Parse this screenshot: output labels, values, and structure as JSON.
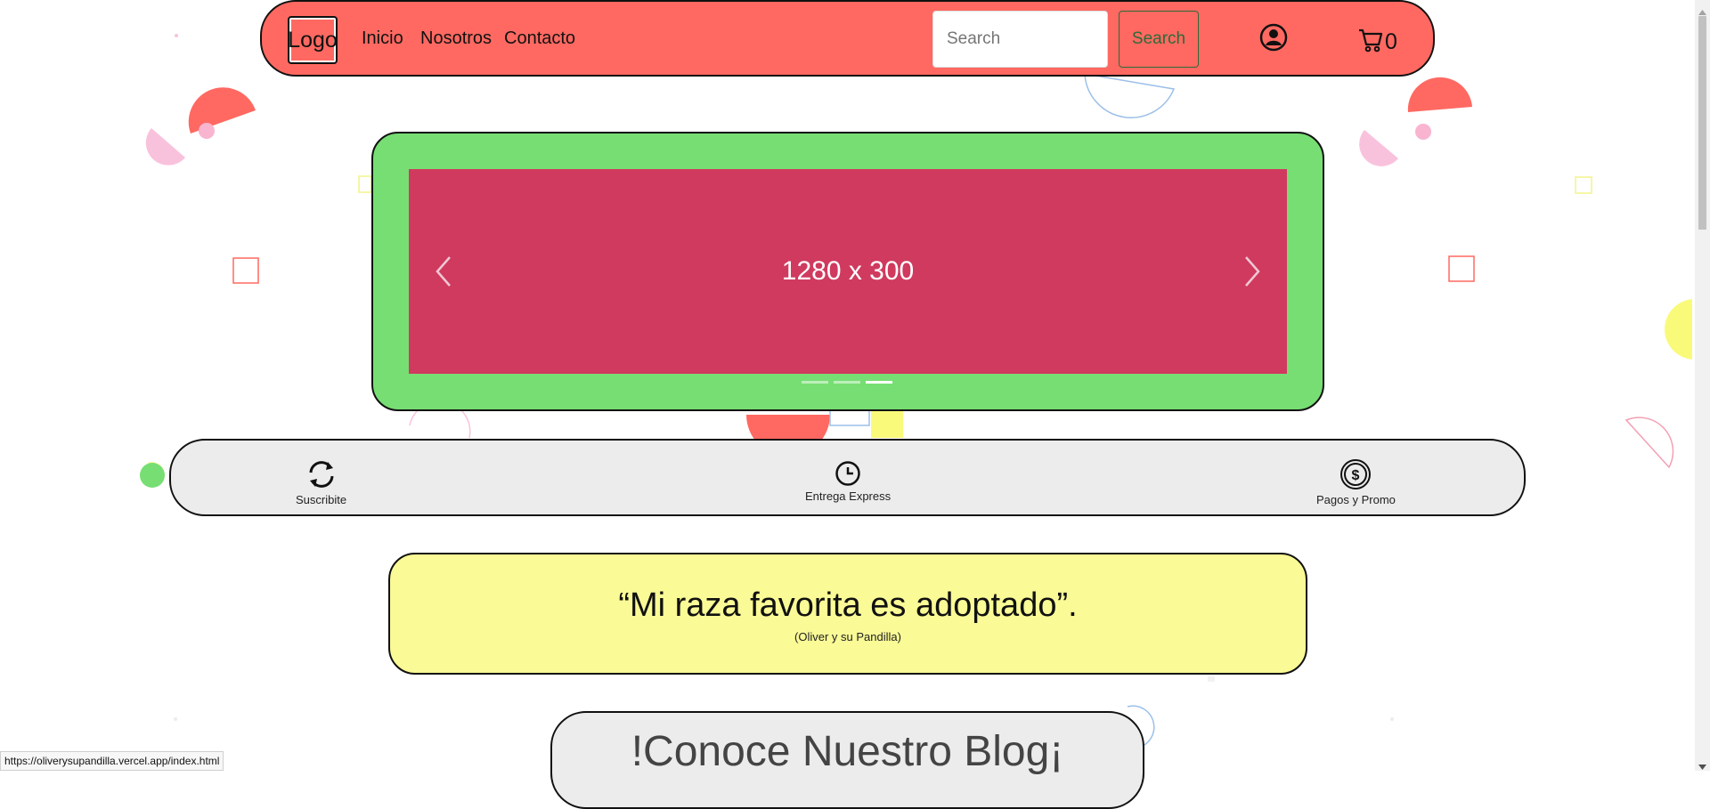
{
  "navbar": {
    "logo": "Logo",
    "links": [
      "Inicio",
      "Nosotros",
      "Contacto"
    ],
    "search_placeholder": "Search",
    "search_button": "Search",
    "cart_count": "0"
  },
  "carousel": {
    "slide_label": "1280 x 300",
    "active_indicator": 3,
    "indicator_count": 3
  },
  "features": [
    {
      "label": "Suscribite",
      "icon": "refresh-icon"
    },
    {
      "label": "Entrega Express",
      "icon": "clock-icon"
    },
    {
      "label": "Pagos y Promo",
      "icon": "dollar-coin-icon"
    }
  ],
  "quote": {
    "text": "“Mi raza favorita es adoptado”.",
    "author": "(Oliver y su Pandilla)"
  },
  "blog": {
    "title": "!Conoce Nuestro Blog¡"
  },
  "status_bar": {
    "url": "https://oliverysupandilla.vercel.app/index.html"
  },
  "colors": {
    "navbar": "#ff6961",
    "carousel_frame": "#77de73",
    "slide": "#d03a5f",
    "feature_bar": "#ececec",
    "quote_box": "#fafa96"
  }
}
